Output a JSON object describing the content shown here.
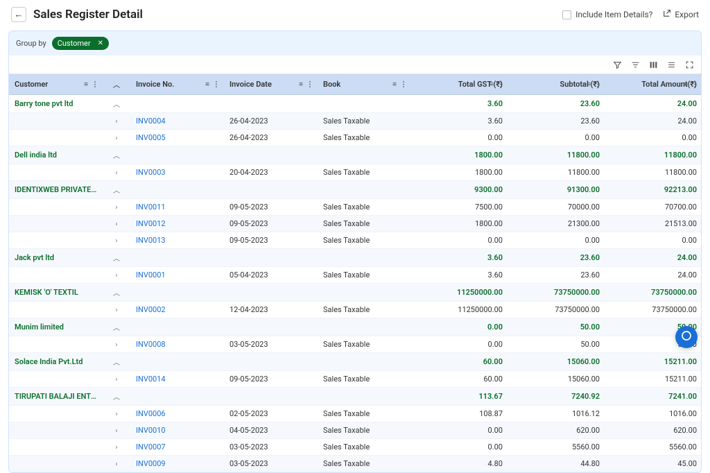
{
  "header": {
    "title": "Sales Register Detail",
    "include_item_label": "Include Item Details?",
    "export_label": "Export"
  },
  "groupby": {
    "label": "Group by",
    "pill": "Customer"
  },
  "columns": {
    "customer": "Customer",
    "invoice_no": "Invoice No.",
    "invoice_date": "Invoice Date",
    "book": "Book",
    "total_gst": "Total GST (₹)",
    "subtotal": "Subtotal (₹)",
    "total_amount": "Total Amount(₹)"
  },
  "groups": [
    {
      "customer": "Barry tone pvt ltd",
      "total_gst": "3.60",
      "subtotal": "23.60",
      "total_amount": "24.00",
      "rows": [
        {
          "inv": "INV0004",
          "date": "26-04-2023",
          "book": "Sales Taxable",
          "gst": "3.60",
          "sub": "23.60",
          "tot": "24.00"
        },
        {
          "inv": "INV0005",
          "date": "26-04-2023",
          "book": "Sales Taxable",
          "gst": "0.00",
          "sub": "0.00",
          "tot": "0.00"
        }
      ]
    },
    {
      "customer": "Dell india ltd",
      "total_gst": "1800.00",
      "subtotal": "11800.00",
      "total_amount": "11800.00",
      "rows": [
        {
          "inv": "INV0003",
          "date": "20-04-2023",
          "book": "Sales Taxable",
          "gst": "1800.00",
          "sub": "11800.00",
          "tot": "11800.00"
        }
      ]
    },
    {
      "customer": "IDENTIXWEB PRIVATE LIMITE...",
      "total_gst": "9300.00",
      "subtotal": "91300.00",
      "total_amount": "92213.00",
      "rows": [
        {
          "inv": "INV0011",
          "date": "09-05-2023",
          "book": "Sales Taxable",
          "gst": "7500.00",
          "sub": "70000.00",
          "tot": "70700.00"
        },
        {
          "inv": "INV0012",
          "date": "09-05-2023",
          "book": "Sales Taxable",
          "gst": "1800.00",
          "sub": "21300.00",
          "tot": "21513.00"
        },
        {
          "inv": "INV0013",
          "date": "09-05-2023",
          "book": "Sales Taxable",
          "gst": "0.00",
          "sub": "0.00",
          "tot": "0.00"
        }
      ]
    },
    {
      "customer": "Jack pvt ltd",
      "total_gst": "3.60",
      "subtotal": "23.60",
      "total_amount": "24.00",
      "rows": [
        {
          "inv": "INV0001",
          "date": "05-04-2023",
          "book": "Sales Taxable",
          "gst": "3.60",
          "sub": "23.60",
          "tot": "24.00"
        }
      ]
    },
    {
      "customer": "KEMISK 'O' TEXTIL",
      "total_gst": "11250000.00",
      "subtotal": "73750000.00",
      "total_amount": "73750000.00",
      "rows": [
        {
          "inv": "INV0002",
          "date": "12-04-2023",
          "book": "Sales Taxable",
          "gst": "11250000.00",
          "sub": "73750000.00",
          "tot": "73750000.00"
        }
      ]
    },
    {
      "customer": "Munim limited",
      "total_gst": "0.00",
      "subtotal": "50.00",
      "total_amount": "50.00",
      "rows": [
        {
          "inv": "INV0008",
          "date": "03-05-2023",
          "book": "Sales Taxable",
          "gst": "0.00",
          "sub": "50.00",
          "tot": "50.00"
        }
      ]
    },
    {
      "customer": "Solace India Pvt.Ltd",
      "total_gst": "60.00",
      "subtotal": "15060.00",
      "total_amount": "15211.00",
      "rows": [
        {
          "inv": "INV0014",
          "date": "09-05-2023",
          "book": "Sales Taxable",
          "gst": "60.00",
          "sub": "15060.00",
          "tot": "15211.00"
        }
      ]
    },
    {
      "customer": "TIRUPATI BALAJI ENTERPRIS...",
      "total_gst": "113.67",
      "subtotal": "7240.92",
      "total_amount": "7241.00",
      "rows": [
        {
          "inv": "INV0006",
          "date": "02-05-2023",
          "book": "Sales Taxable",
          "gst": "108.87",
          "sub": "1016.12",
          "tot": "1016.00"
        },
        {
          "inv": "INV0010",
          "date": "04-05-2023",
          "book": "Sales Taxable",
          "gst": "0.00",
          "sub": "620.00",
          "tot": "620.00"
        },
        {
          "inv": "INV0007",
          "date": "03-05-2023",
          "book": "Sales Taxable",
          "gst": "0.00",
          "sub": "5560.00",
          "tot": "5560.00"
        },
        {
          "inv": "INV0009",
          "date": "03-05-2023",
          "book": "Sales Taxable",
          "gst": "4.80",
          "sub": "44.80",
          "tot": "45.00"
        }
      ]
    }
  ]
}
